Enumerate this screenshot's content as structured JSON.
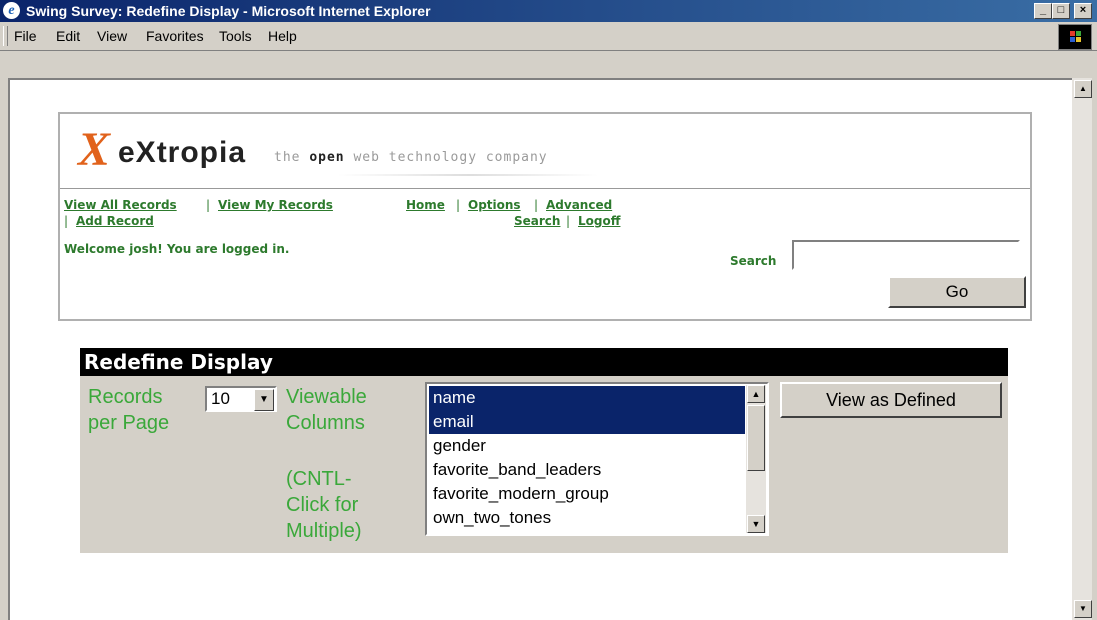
{
  "window": {
    "title": "Swing Survey: Redefine Display - Microsoft Internet Explorer",
    "controls": [
      "_",
      "□",
      "×"
    ]
  },
  "menu": [
    {
      "label": "File"
    },
    {
      "label": "Edit"
    },
    {
      "label": "View"
    },
    {
      "label": "Favorites"
    },
    {
      "label": "Tools"
    },
    {
      "label": "Help"
    }
  ],
  "logo": {
    "mark": "X",
    "word": "eXtropia",
    "tagline_pre": "the ",
    "tagline_bold": "open",
    "tagline_post": " web technology company"
  },
  "nav": {
    "view_all": "View All Records",
    "sep1": "|",
    "view_my": "View My Records",
    "home": "Home",
    "sep2": "|",
    "options": "Options",
    "sep3": "|",
    "advanced": "Advanced",
    "sep4": "|",
    "add_record": "Add Record",
    "search": "Search",
    "sep5": "|",
    "logoff": "Logoff"
  },
  "welcome": "Welcome josh! You are logged in.",
  "search": {
    "label": "Search",
    "value": "",
    "go_label": "Go"
  },
  "panel": {
    "title": "Redefine Display",
    "records_label_1": "Records",
    "records_label_2": "per Page",
    "records_value": "10",
    "viewable_1": "Viewable",
    "viewable_2": "Columns",
    "hint_1": "(CNTL-",
    "hint_2": "Click for",
    "hint_3": "Multiple)",
    "columns": [
      {
        "label": "name",
        "selected": true
      },
      {
        "label": "email",
        "selected": true
      },
      {
        "label": "gender",
        "selected": false
      },
      {
        "label": "favorite_band_leaders",
        "selected": false
      },
      {
        "label": "favorite_modern_group",
        "selected": false
      },
      {
        "label": "own_two_tones",
        "selected": false
      }
    ],
    "view_button": "View as Defined"
  },
  "colors": {
    "green_text": "#3aa83a",
    "link_green": "#2d7a2d",
    "selection": "#0a246a",
    "logo_orange": "#e1621b"
  }
}
